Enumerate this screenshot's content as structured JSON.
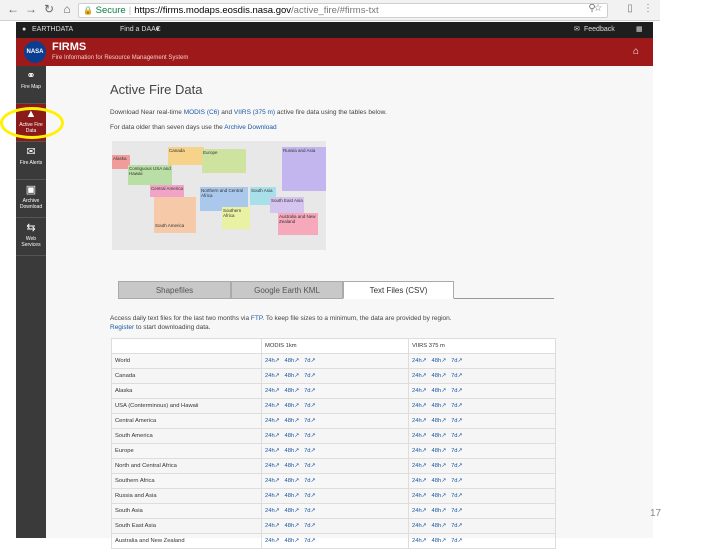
{
  "browser": {
    "secure_label": "Secure",
    "url_host": "https://firms.modaps.eosdis.nasa.gov",
    "url_path": "/active_fire/#firms-txt"
  },
  "earthdata_bar": {
    "brand": "EARTHDATA",
    "find_daac": "Find a DAAC",
    "feedback": "Feedback"
  },
  "header": {
    "logo_text": "NASA",
    "title": "FIRMS",
    "subtitle": "Fire Information for Resource Management System"
  },
  "sidebar": {
    "items": [
      {
        "label": "Fire Map"
      },
      {
        "label": "Active Fire Data"
      },
      {
        "label": "Fire Alerts"
      },
      {
        "label": "Archive Download"
      },
      {
        "label": "Web Services"
      }
    ]
  },
  "main": {
    "heading": "Active Fire Data",
    "intro_pre": "Download Near real-time ",
    "intro_modis": "MODIS (C6)",
    "intro_and": " and ",
    "intro_viirs": "VIIRS (375 m)",
    "intro_post": " active fire data using the tables below.",
    "archive_pre": "For data older than seven days use the ",
    "archive_link": "Archive Download",
    "access_line1_pre": "Access daily text files for the last two months via ",
    "access_ftp": "FTP",
    "access_line1_post": ". To keep file sizes to a minimum, the data are provided by region.",
    "access_register": "Register",
    "access_line2_post": " to start downloading data."
  },
  "map_regions": [
    {
      "label": "Canada"
    },
    {
      "label": "Europe"
    },
    {
      "label": "Russia and Asia"
    },
    {
      "label": "Alaska"
    },
    {
      "label": "Contiguous USA and Hawaii"
    },
    {
      "label": "Central America"
    },
    {
      "label": "Northern and Central Africa"
    },
    {
      "label": "South Asia"
    },
    {
      "label": "South East Asia"
    },
    {
      "label": "Southern Africa"
    },
    {
      "label": "South America"
    },
    {
      "label": "Australia and New Zealand"
    }
  ],
  "tabs": [
    {
      "label": "Shapefiles"
    },
    {
      "label": "Google Earth KML"
    },
    {
      "label": "Text Files (CSV)"
    }
  ],
  "table": {
    "col_region": "",
    "col_modis": "MODIS 1km",
    "col_viirs": "VIIRS 375 m",
    "links": [
      "24h",
      "48h",
      "7d"
    ],
    "rows": [
      "World",
      "Canada",
      "Alaska",
      "USA (Conterminous) and Hawaii",
      "Central America",
      "South America",
      "Europe",
      "North and Central Africa",
      "Southern Africa",
      "Russia and Asia",
      "South Asia",
      "South East Asia",
      "Australia and New Zealand"
    ]
  },
  "slide_number": "17"
}
